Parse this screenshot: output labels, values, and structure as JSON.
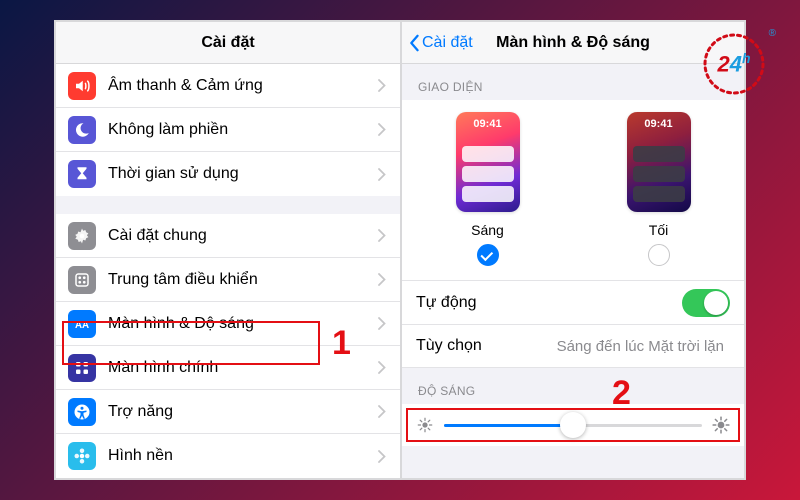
{
  "colors": {
    "accent": "#007aff",
    "highlight": "#e40f14",
    "switchOn": "#34c759"
  },
  "left": {
    "title": "Cài đặt",
    "groups": [
      {
        "items": [
          {
            "icon": "sound-icon",
            "iconBg": "#ff3b30",
            "label": "Âm thanh & Cảm ứng"
          },
          {
            "icon": "moon-icon",
            "iconBg": "#5856d6",
            "label": "Không làm phiền"
          },
          {
            "icon": "hourglass-icon",
            "iconBg": "#5856d6",
            "label": "Thời gian sử dụng"
          }
        ]
      },
      {
        "items": [
          {
            "icon": "gear-icon",
            "iconBg": "#8e8e93",
            "label": "Cài đặt chung"
          },
          {
            "icon": "control-icon",
            "iconBg": "#8e8e93",
            "label": "Trung tâm điều khiển"
          },
          {
            "icon": "aa-icon",
            "iconBg": "#007aff",
            "label": "Màn hình & Độ sáng",
            "highlight": true
          },
          {
            "icon": "grid-icon",
            "iconBg": "#3634a3",
            "label": "Màn hình chính"
          },
          {
            "icon": "accessibility-icon",
            "iconBg": "#007aff",
            "label": "Trợ năng"
          },
          {
            "icon": "flower-icon",
            "iconBg": "#29bdec",
            "label": "Hình nền"
          }
        ]
      }
    ],
    "callout": "1"
  },
  "right": {
    "back": "Cài đặt",
    "title": "Màn hình & Độ sáng",
    "sectionAppearance": "GIAO DIỆN",
    "modes": [
      {
        "label": "Sáng",
        "clock": "09:41",
        "selected": true,
        "theme": "light"
      },
      {
        "label": "Tối",
        "clock": "09:41",
        "selected": false,
        "theme": "dark"
      }
    ],
    "autoRow": {
      "label": "Tự động",
      "on": true
    },
    "optionRow": {
      "label": "Tùy chọn",
      "value": "Sáng đến lúc Mặt trời lặn"
    },
    "sectionBrightness": "ĐỘ SÁNG",
    "brightnessPercent": 50,
    "callout": "2"
  },
  "badge": {
    "two": "2",
    "four": "4",
    "h": "h",
    "reg": "®"
  }
}
